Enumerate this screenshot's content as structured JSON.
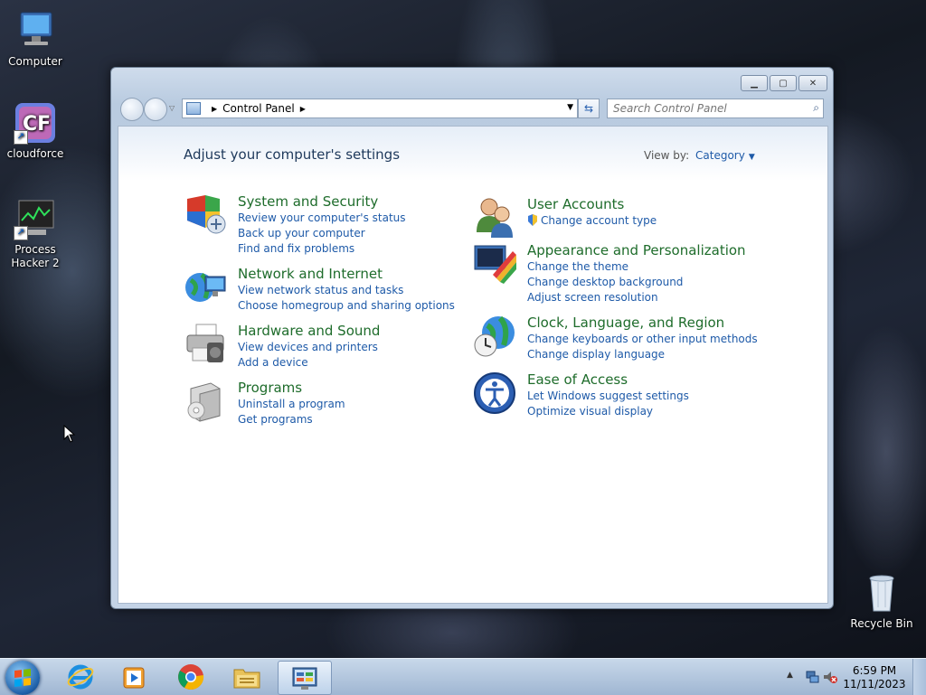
{
  "desktop": {
    "icons": [
      {
        "label": "Computer"
      },
      {
        "label": "cloudforce"
      },
      {
        "label": "Process Hacker 2"
      },
      {
        "label": "Recycle Bin"
      }
    ]
  },
  "window": {
    "address": {
      "path": "Control Panel"
    },
    "search": {
      "placeholder": "Search Control Panel"
    },
    "heading": "Adjust your computer's settings",
    "view_by_label": "View by:",
    "view_by_value": "Category",
    "categories": [
      {
        "title": "System and Security",
        "icon": "shield-icon",
        "links": [
          "Review your computer's status",
          "Back up your computer",
          "Find and fix problems"
        ]
      },
      {
        "title": "Network and Internet",
        "icon": "network-globe-icon",
        "links": [
          "View network status and tasks",
          "Choose homegroup and sharing options"
        ]
      },
      {
        "title": "Hardware and Sound",
        "icon": "printer-icon",
        "links": [
          "View devices and printers",
          "Add a device"
        ]
      },
      {
        "title": "Programs",
        "icon": "programs-box-icon",
        "links": [
          "Uninstall a program",
          "Get programs"
        ]
      },
      {
        "title": "User Accounts",
        "icon": "users-icon",
        "links": [
          "Change account type"
        ]
      },
      {
        "title": "Appearance and Personalization",
        "icon": "display-palette-icon",
        "links": [
          "Change the theme",
          "Change desktop background",
          "Adjust screen resolution"
        ]
      },
      {
        "title": "Clock, Language, and Region",
        "icon": "globe-clock-icon",
        "links": [
          "Change keyboards or other input methods",
          "Change display language"
        ]
      },
      {
        "title": "Ease of Access",
        "icon": "ease-of-access-icon",
        "links": [
          "Let Windows suggest settings",
          "Optimize visual display"
        ]
      }
    ]
  },
  "taskbar": {
    "items": [
      "start-orb",
      "internet-explorer",
      "media-player",
      "chrome",
      "file-explorer",
      "control-panel"
    ],
    "clock": {
      "time": "6:59 PM",
      "date": "11/11/2023"
    }
  },
  "colors": {
    "link": "#1e5aa8",
    "category_title": "#1e6c2b",
    "heading": "#1e395b"
  }
}
